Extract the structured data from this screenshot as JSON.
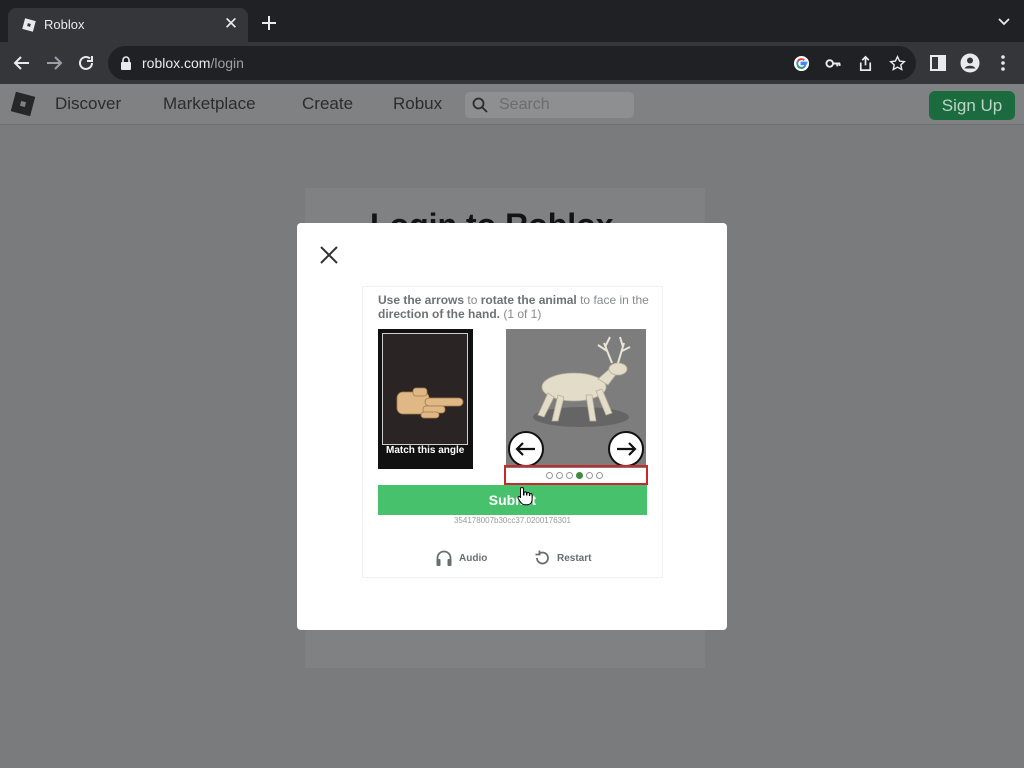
{
  "browser": {
    "tab_title": "Roblox",
    "url_domain": "roblox.com",
    "url_path": "/login"
  },
  "site_nav": {
    "links": [
      "Discover",
      "Marketplace",
      "Create",
      "Robux"
    ],
    "search_placeholder": "Search",
    "signup_label": "Sign Up"
  },
  "background": {
    "heading": "Login to Roblox"
  },
  "captcha": {
    "instruction": {
      "part1": "Use the arrows",
      "part2": " to ",
      "part3": "rotate the animal",
      "part4": " to face in the ",
      "part5": "direction of the hand.",
      "part6": " (1 of 1)"
    },
    "reference_label": "Match this angle",
    "submit_label": "Submit",
    "session_id": "354178007b30cc37.0200176301",
    "audio_label": "Audio",
    "restart_label": "Restart",
    "dots": [
      {
        "active": false
      },
      {
        "active": false
      },
      {
        "active": false
      },
      {
        "active": true
      },
      {
        "active": false
      },
      {
        "active": false
      }
    ]
  },
  "colors": {
    "submit_green": "#47c16c",
    "signup_green": "#1c6b3f",
    "selector_red": "#c8282b"
  }
}
